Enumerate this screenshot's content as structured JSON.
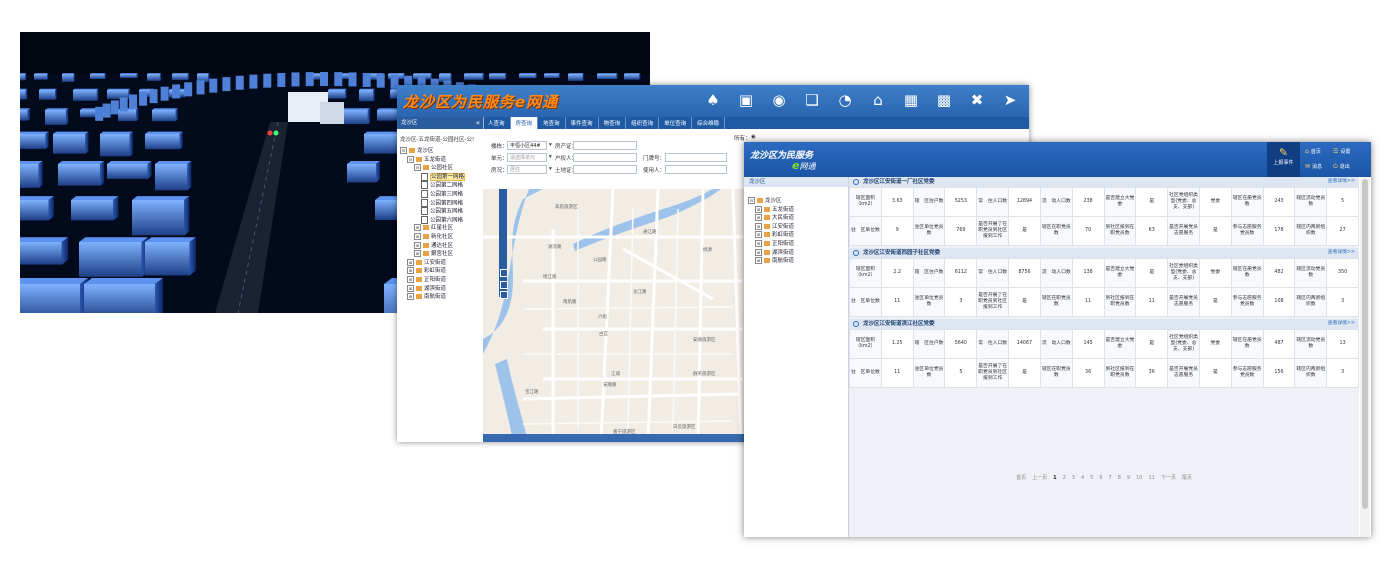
{
  "query_app": {
    "logo": "龙沙区为民服务e网通",
    "nav_icons": [
      "people-icon",
      "id-card-icon",
      "globe-icon",
      "window-icon",
      "pie-chart-icon",
      "building-icon",
      "calendar-icon",
      "grid-icon",
      "tools-icon",
      "arrow-right-icon"
    ],
    "tabs": [
      "人查询",
      "房查询",
      "地查询",
      "事件查询",
      "物查询",
      "组织查询",
      "单位查询",
      "综合维稳"
    ],
    "sidebar_title": "龙沙区",
    "collapse": "«",
    "path": "龙沙区-五龙街道-公园社区-公!",
    "tree": [
      {
        "label": "龙沙区",
        "level": 0,
        "toggle": "⊟",
        "kind": "folder"
      },
      {
        "label": "五龙街道",
        "level": 1,
        "toggle": "⊟",
        "kind": "folder"
      },
      {
        "label": "公园社区",
        "level": 2,
        "toggle": "⊟",
        "kind": "folder"
      },
      {
        "label": "公园第一网格",
        "level": 3,
        "toggle": "",
        "kind": "page",
        "selected": true
      },
      {
        "label": "公园第二网格",
        "level": 3,
        "toggle": "",
        "kind": "page"
      },
      {
        "label": "公园第三网格",
        "level": 3,
        "toggle": "",
        "kind": "page"
      },
      {
        "label": "公园第四网格",
        "level": 3,
        "toggle": "",
        "kind": "page"
      },
      {
        "label": "公园第五网格",
        "level": 3,
        "toggle": "",
        "kind": "page"
      },
      {
        "label": "公园第六网格",
        "level": 3,
        "toggle": "",
        "kind": "page"
      },
      {
        "label": "红星社区",
        "level": 2,
        "toggle": "⊞",
        "kind": "folder"
      },
      {
        "label": "新化社区",
        "level": 2,
        "toggle": "⊞",
        "kind": "folder"
      },
      {
        "label": "通达社区",
        "level": 2,
        "toggle": "⊞",
        "kind": "folder"
      },
      {
        "label": "銀宮社区",
        "level": 2,
        "toggle": "⊞",
        "kind": "folder"
      },
      {
        "label": "江安街道",
        "level": 1,
        "toggle": "⊞",
        "kind": "folder"
      },
      {
        "label": "彩虹街道",
        "level": 1,
        "toggle": "⊞",
        "kind": "folder"
      },
      {
        "label": "正阳街道",
        "level": 1,
        "toggle": "⊞",
        "kind": "folder"
      },
      {
        "label": "湖滨街道",
        "level": 1,
        "toggle": "⊞",
        "kind": "folder"
      },
      {
        "label": "南航街道",
        "level": 1,
        "toggle": "⊞",
        "kind": "folder"
      }
    ],
    "form": {
      "building_label": "楼栋：",
      "building_value": "丰恒小区44#",
      "house_cert_label": "房产证：",
      "unit_label": "单元：",
      "unit_placeholder": "请选择单元",
      "owner_label": "户权人：",
      "door_label": "门牌号：",
      "status_label": "房况：",
      "status_placeholder": "居住",
      "land_label": "土地证：",
      "user_label": "使用人：",
      "all_label": "所有："
    },
    "map_labels": [
      "高航旅游区",
      "湖流路",
      "通江路",
      "公园路",
      "杨江路",
      "龙江路",
      "南航路",
      "六街",
      "桃源",
      "江城",
      "安顺路",
      "古宜",
      "群英旅游区",
      "宝江路",
      "嘉宁旅游区",
      "安顺旅游区",
      "白云旅游区"
    ]
  },
  "party_app": {
    "logo_line1": "龙沙区为民服务",
    "logo_e": "e",
    "logo_line2": "网通",
    "upload_label": "上报事件",
    "links": {
      "home": "首页",
      "settings": "设置",
      "messages": "消息",
      "logout": "退出"
    },
    "sidebar_title": "龙沙区",
    "tree": [
      {
        "label": "龙沙区",
        "toggle": "⊟",
        "level": 0
      },
      {
        "label": "五龙街道",
        "toggle": "⊞",
        "level": 1
      },
      {
        "label": "大民街道",
        "toggle": "⊞",
        "level": 1
      },
      {
        "label": "江安街道",
        "toggle": "⊞",
        "level": 1
      },
      {
        "label": "彩虹街道",
        "toggle": "⊞",
        "level": 1
      },
      {
        "label": "正阳街道",
        "toggle": "⊞",
        "level": 1
      },
      {
        "label": "湖滨街道",
        "toggle": "⊞",
        "level": 1
      },
      {
        "label": "南航街道",
        "toggle": "⊞",
        "level": 1
      }
    ],
    "more_label": "查看详情>>",
    "sections": [
      {
        "title": "龙沙区江安街道一厂社区党委",
        "rows": [
          [
            "辖区面积（km2）",
            "3.63",
            "辖　区住户数",
            "5253",
            "常　住人口数",
            "12894",
            "流　动人口数",
            "238",
            "是否建立大党委",
            "是",
            "社区党组织类型(党委、总支、支部)",
            "党委",
            "辖区在册党员数",
            "243",
            "辖区流动党员数",
            "5"
          ],
          [
            "驻　区单位数",
            "9",
            "驻区单位党员数",
            "769",
            "是否开展了在职党员到社区报到工作",
            "是",
            "辖区在职党员数",
            "70",
            "到社区报到在职党员数",
            "63",
            "是否开展党员志愿服务",
            "是",
            "参与志愿服务党员数",
            "178",
            "辖区内两新组织数",
            "27"
          ]
        ]
      },
      {
        "title": "龙沙区江安街道西园子社区党委",
        "rows": [
          [
            "辖区面积（km2）",
            "2.2",
            "辖　区住户数",
            "6112",
            "常　住人口数",
            "8756",
            "流　动人口数",
            "138",
            "是否建立大党委",
            "是",
            "社区党组织类型(党委、总支、支部)",
            "党委",
            "辖区在册党员数",
            "482",
            "辖区流动党员数",
            "350"
          ],
          [
            "驻　区单位数",
            "11",
            "驻区单位党员数",
            "3",
            "是否开展了在职党员到社区报到工作",
            "是",
            "辖区在职党员数",
            "11",
            "到社区报到在职党员数",
            "11",
            "是否开展党员志愿服务",
            "是",
            "参与志愿服务党员数",
            "108",
            "辖区内两新组织数",
            "3"
          ]
        ]
      },
      {
        "title": "龙沙区江安街道滨江社区党委",
        "rows": [
          [
            "辖区面积（km2）",
            "1.25",
            "辖　区住户数",
            "5640",
            "常　住人口数",
            "14067",
            "流　动人口数",
            "145",
            "是否建立大党委",
            "是",
            "社区党组织类型(党委、总支、支部)",
            "党委",
            "辖区在册党员数",
            "487",
            "辖区流动党员数",
            "13"
          ],
          [
            "驻　区单位数",
            "11",
            "驻区单位党员数",
            "5",
            "是否开展了在职党员到社区报到工作",
            "是",
            "辖区在职党员数",
            "36",
            "到社区报到在职党员数",
            "36",
            "是否开展党员志愿服务",
            "是",
            "参与志愿服务党员数",
            "156",
            "辖区内两新组织数",
            "3"
          ]
        ]
      }
    ],
    "pager": {
      "first": "首页",
      "prev": "上一页",
      "pages": [
        "1",
        "2",
        "3",
        "4",
        "5",
        "6",
        "7",
        "8",
        "9",
        "10",
        "11"
      ],
      "current": "1",
      "next": "下一页",
      "last": "尾页"
    }
  }
}
